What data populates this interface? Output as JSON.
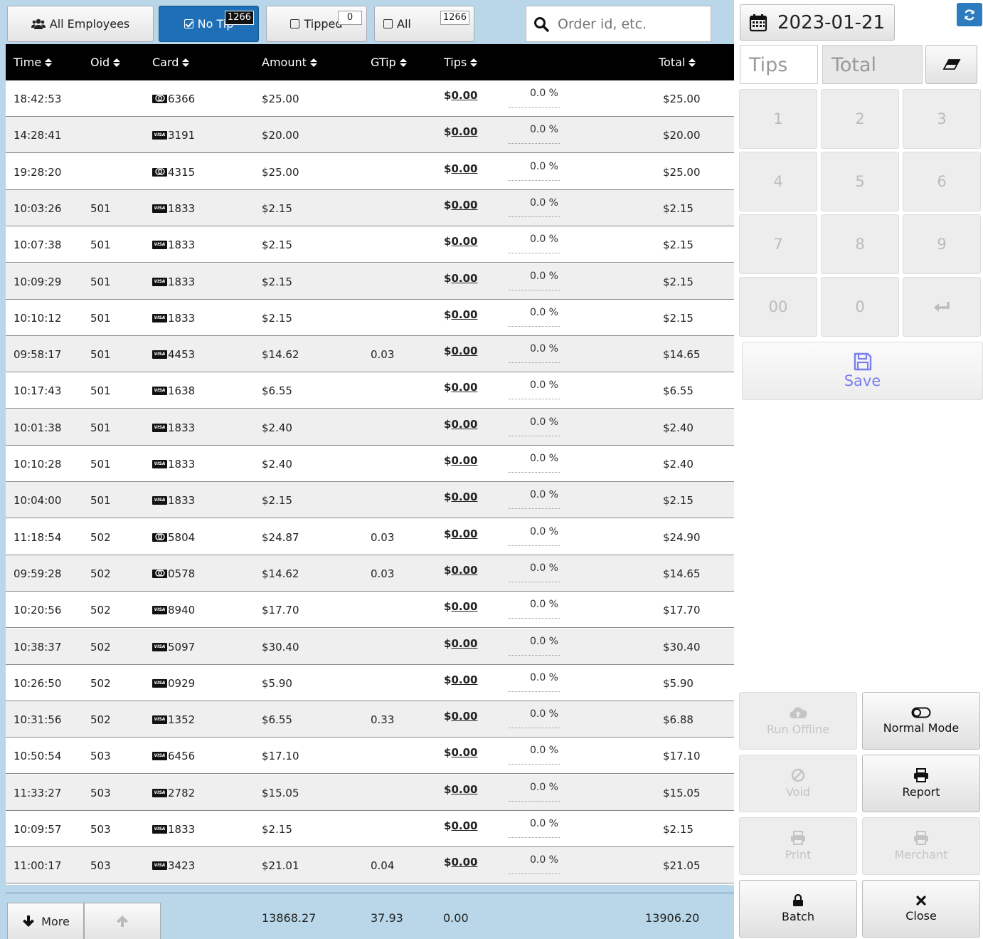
{
  "filters": {
    "employees_label": "All Employees",
    "no_tip_label": "No Tip",
    "no_tip_count": "1266",
    "tipped_label": "Tipped",
    "tipped_count": "0",
    "all_label": "All",
    "all_count": "1266"
  },
  "search": {
    "placeholder": "Order id, etc."
  },
  "columns": {
    "time": "Time",
    "oid": "Oid",
    "card": "Card",
    "amount": "Amount",
    "gtip": "GTip",
    "tips": "Tips",
    "total": "Total"
  },
  "rows": [
    {
      "time": "18:42:53",
      "oid": "",
      "brand": "mc",
      "card": "6366",
      "amount": "$25.00",
      "gtip": "",
      "tip_currency": "$",
      "tip": "0.00",
      "pct": "0.0 %",
      "total": "$25.00"
    },
    {
      "time": "14:28:41",
      "oid": "",
      "brand": "visa",
      "card": "3191",
      "amount": "$20.00",
      "gtip": "",
      "tip_currency": "$",
      "tip": "0.00",
      "pct": "0.0 %",
      "total": "$20.00"
    },
    {
      "time": "19:28:20",
      "oid": "",
      "brand": "mc",
      "card": "4315",
      "amount": "$25.00",
      "gtip": "",
      "tip_currency": "$",
      "tip": "0.00",
      "pct": "0.0 %",
      "total": "$25.00"
    },
    {
      "time": "10:03:26",
      "oid": "501",
      "brand": "visa",
      "card": "1833",
      "amount": "$2.15",
      "gtip": "",
      "tip_currency": "$",
      "tip": "0.00",
      "pct": "0.0 %",
      "total": "$2.15"
    },
    {
      "time": "10:07:38",
      "oid": "501",
      "brand": "visa",
      "card": "1833",
      "amount": "$2.15",
      "gtip": "",
      "tip_currency": "$",
      "tip": "0.00",
      "pct": "0.0 %",
      "total": "$2.15"
    },
    {
      "time": "10:09:29",
      "oid": "501",
      "brand": "visa",
      "card": "1833",
      "amount": "$2.15",
      "gtip": "",
      "tip_currency": "$",
      "tip": "0.00",
      "pct": "0.0 %",
      "total": "$2.15"
    },
    {
      "time": "10:10:12",
      "oid": "501",
      "brand": "visa",
      "card": "1833",
      "amount": "$2.15",
      "gtip": "",
      "tip_currency": "$",
      "tip": "0.00",
      "pct": "0.0 %",
      "total": "$2.15"
    },
    {
      "time": "09:58:17",
      "oid": "501",
      "brand": "visa",
      "card": "4453",
      "amount": "$14.62",
      "gtip": "0.03",
      "tip_currency": "$",
      "tip": "0.00",
      "pct": "0.0 %",
      "total": "$14.65"
    },
    {
      "time": "10:17:43",
      "oid": "501",
      "brand": "visa",
      "card": "1638",
      "amount": "$6.55",
      "gtip": "",
      "tip_currency": "$",
      "tip": "0.00",
      "pct": "0.0 %",
      "total": "$6.55"
    },
    {
      "time": "10:01:38",
      "oid": "501",
      "brand": "visa",
      "card": "1833",
      "amount": "$2.40",
      "gtip": "",
      "tip_currency": "$",
      "tip": "0.00",
      "pct": "0.0 %",
      "total": "$2.40"
    },
    {
      "time": "10:10:28",
      "oid": "501",
      "brand": "visa",
      "card": "1833",
      "amount": "$2.40",
      "gtip": "",
      "tip_currency": "$",
      "tip": "0.00",
      "pct": "0.0 %",
      "total": "$2.40"
    },
    {
      "time": "10:04:00",
      "oid": "501",
      "brand": "visa",
      "card": "1833",
      "amount": "$2.15",
      "gtip": "",
      "tip_currency": "$",
      "tip": "0.00",
      "pct": "0.0 %",
      "total": "$2.15"
    },
    {
      "time": "11:18:54",
      "oid": "502",
      "brand": "mc",
      "card": "5804",
      "amount": "$24.87",
      "gtip": "0.03",
      "tip_currency": "$",
      "tip": "0.00",
      "pct": "0.0 %",
      "total": "$24.90"
    },
    {
      "time": "09:59:28",
      "oid": "502",
      "brand": "mc",
      "card": "0578",
      "amount": "$14.62",
      "gtip": "0.03",
      "tip_currency": "$",
      "tip": "0.00",
      "pct": "0.0 %",
      "total": "$14.65"
    },
    {
      "time": "10:20:56",
      "oid": "502",
      "brand": "visa",
      "card": "8940",
      "amount": "$17.70",
      "gtip": "",
      "tip_currency": "$",
      "tip": "0.00",
      "pct": "0.0 %",
      "total": "$17.70"
    },
    {
      "time": "10:38:37",
      "oid": "502",
      "brand": "visa",
      "card": "5097",
      "amount": "$30.40",
      "gtip": "",
      "tip_currency": "$",
      "tip": "0.00",
      "pct": "0.0 %",
      "total": "$30.40"
    },
    {
      "time": "10:26:50",
      "oid": "502",
      "brand": "visa",
      "card": "0929",
      "amount": "$5.90",
      "gtip": "",
      "tip_currency": "$",
      "tip": "0.00",
      "pct": "0.0 %",
      "total": "$5.90"
    },
    {
      "time": "10:31:56",
      "oid": "502",
      "brand": "visa",
      "card": "1352",
      "amount": "$6.55",
      "gtip": "0.33",
      "tip_currency": "$",
      "tip": "0.00",
      "pct": "0.0 %",
      "total": "$6.88"
    },
    {
      "time": "10:50:54",
      "oid": "503",
      "brand": "visa",
      "card": "6456",
      "amount": "$17.10",
      "gtip": "",
      "tip_currency": "$",
      "tip": "0.00",
      "pct": "0.0 %",
      "total": "$17.10"
    },
    {
      "time": "11:33:27",
      "oid": "503",
      "brand": "visa",
      "card": "2782",
      "amount": "$15.05",
      "gtip": "",
      "tip_currency": "$",
      "tip": "0.00",
      "pct": "0.0 %",
      "total": "$15.05"
    },
    {
      "time": "10:09:57",
      "oid": "503",
      "brand": "visa",
      "card": "1833",
      "amount": "$2.15",
      "gtip": "",
      "tip_currency": "$",
      "tip": "0.00",
      "pct": "0.0 %",
      "total": "$2.15"
    },
    {
      "time": "11:00:17",
      "oid": "503",
      "brand": "visa",
      "card": "3423",
      "amount": "$21.01",
      "gtip": "0.04",
      "tip_currency": "$",
      "tip": "0.00",
      "pct": "0.0 %",
      "total": "$21.05"
    }
  ],
  "footer": {
    "more_label": "More",
    "amount_sum": "13868.27",
    "gtip_sum": "37.93",
    "tips_sum": "0.00",
    "total_sum": "13906.20"
  },
  "right": {
    "date": "2023-01-21",
    "tips_placeholder": "Tips",
    "total_placeholder": "Total",
    "keys": [
      "1",
      "2",
      "3",
      "4",
      "5",
      "6",
      "7",
      "8",
      "9",
      "00",
      "0"
    ],
    "save_label": "Save",
    "run_offline_label": "Run Offline",
    "normal_mode_label": "Normal Mode",
    "void_label": "Void",
    "report_label": "Report",
    "print_label": "Print",
    "merchant_label": "Merchant",
    "batch_label": "Batch",
    "close_label": "Close"
  },
  "colors": {
    "accent": "#1e6fb5",
    "header_bg": "#000000",
    "pane_bg": "#b9d7e8",
    "save_color": "#7a7ef0",
    "refresh_bg": "#2d7bbf"
  }
}
